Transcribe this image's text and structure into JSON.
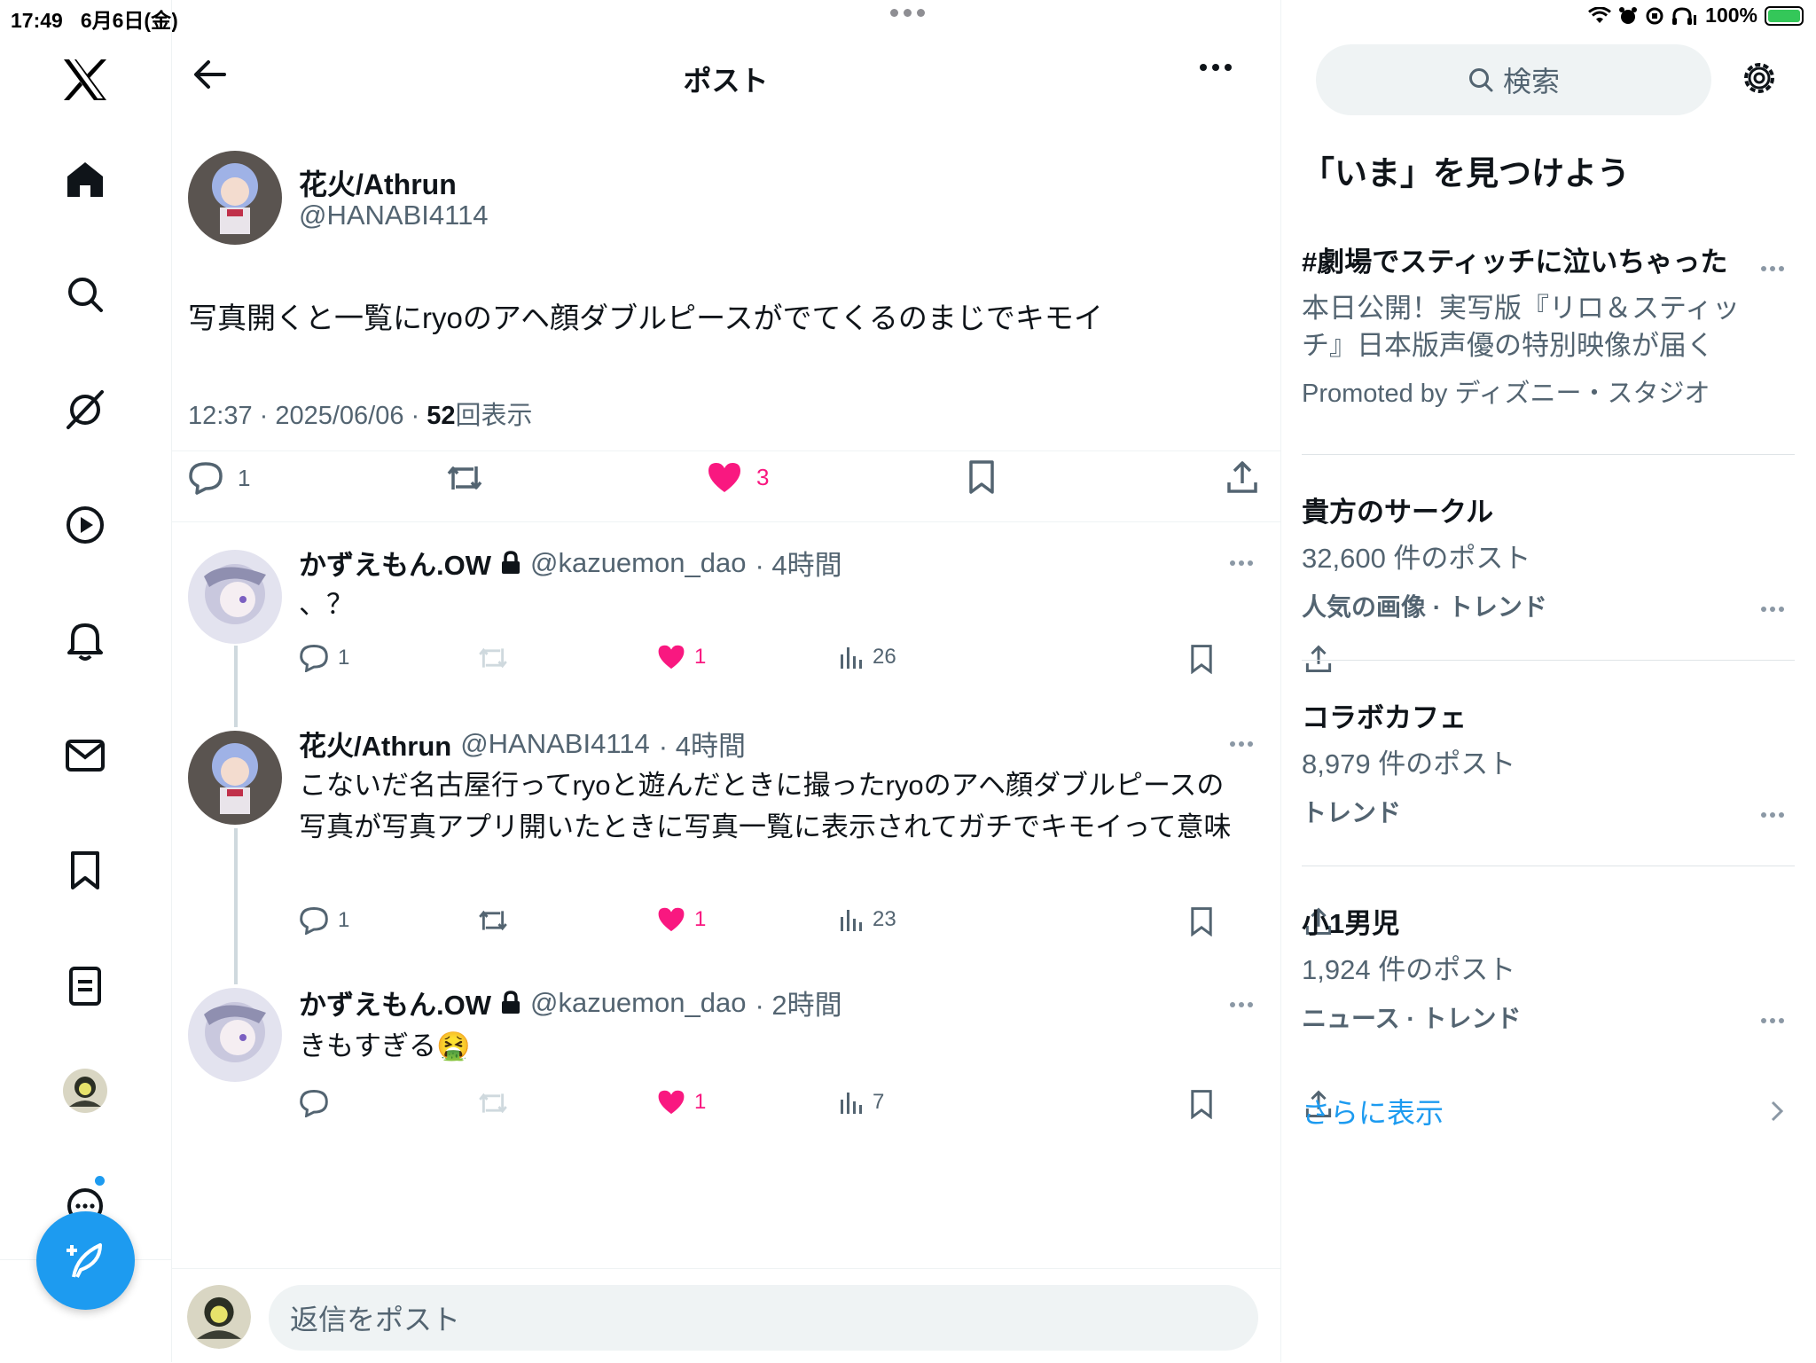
{
  "status_bar": {
    "time": "17:49",
    "date": "6月6日(金)",
    "battery": "100%",
    "battery_level": 1.0
  },
  "nav": {
    "items": [
      "logo-x",
      "home",
      "explore",
      "grok",
      "video",
      "notifications",
      "messages",
      "bookmarks",
      "lists",
      "profile",
      "more"
    ]
  },
  "header": {
    "title": "ポスト"
  },
  "post": {
    "name": "花火/Athrun",
    "handle": "@HANABI4114",
    "text": "写真開くと一覧にryoのアヘ顔ダブルピースがでてくるのまじでキモイ",
    "time": "12:37 · 2025/06/06 · ",
    "views": "52",
    "views_label": "回表示",
    "replies": "1",
    "likes": "3"
  },
  "replies": [
    {
      "name": "かずえもん.OW",
      "locked": true,
      "handle": "@kazuemon_dao",
      "time": "· 4時間",
      "text": "、？",
      "replies": "1",
      "likes": "1",
      "views": "26",
      "reposted_state": "disabled"
    },
    {
      "name": "花火/Athrun",
      "locked": false,
      "handle": "@HANABI4114",
      "time": "· 4時間",
      "text": "こないだ名古屋行ってryoと遊んだときに撮ったryoのアヘ顔ダブルピースの写真が写真アプリ開いたときに写真一覧に表示されてガチでキモイって意味",
      "replies": "1",
      "likes": "1",
      "views": "23",
      "reposted_state": "enabled"
    },
    {
      "name": "かずえもん.OW",
      "locked": true,
      "handle": "@kazuemon_dao",
      "time": "· 2時間",
      "text": "きもすぎる🤮",
      "replies": "",
      "likes": "1",
      "views": "7",
      "reposted_state": "disabled"
    }
  ],
  "reply_box": {
    "placeholder": "返信をポスト"
  },
  "sidebar": {
    "search_placeholder": "検索",
    "explore_title": "「いま」を見つけよう",
    "trends": [
      {
        "title": "#劇場でスティッチに泣いちゃった",
        "promo_line1": "本日公開！実写版『リロ＆スティッ",
        "promo_line2": "チ』日本版声優の特別映像が届く",
        "promoted": "Promoted by ディズニー・スタジオ"
      },
      {
        "title": "貴方のサークル",
        "count": "32,600 件のポスト",
        "category": "人気の画像 · トレンド"
      },
      {
        "title": "コラボカフェ",
        "count": "8,979 件のポスト",
        "category": "トレンド"
      },
      {
        "title": "小1男児",
        "count": "1,924 件のポスト",
        "category": "ニュース · トレンド"
      }
    ],
    "show_more": "さらに表示"
  },
  "colors": {
    "accent": "#1d9bf0",
    "like": "#f91880",
    "text": "#0f1419",
    "secondary": "#536471",
    "battery_green": "#34c759"
  }
}
